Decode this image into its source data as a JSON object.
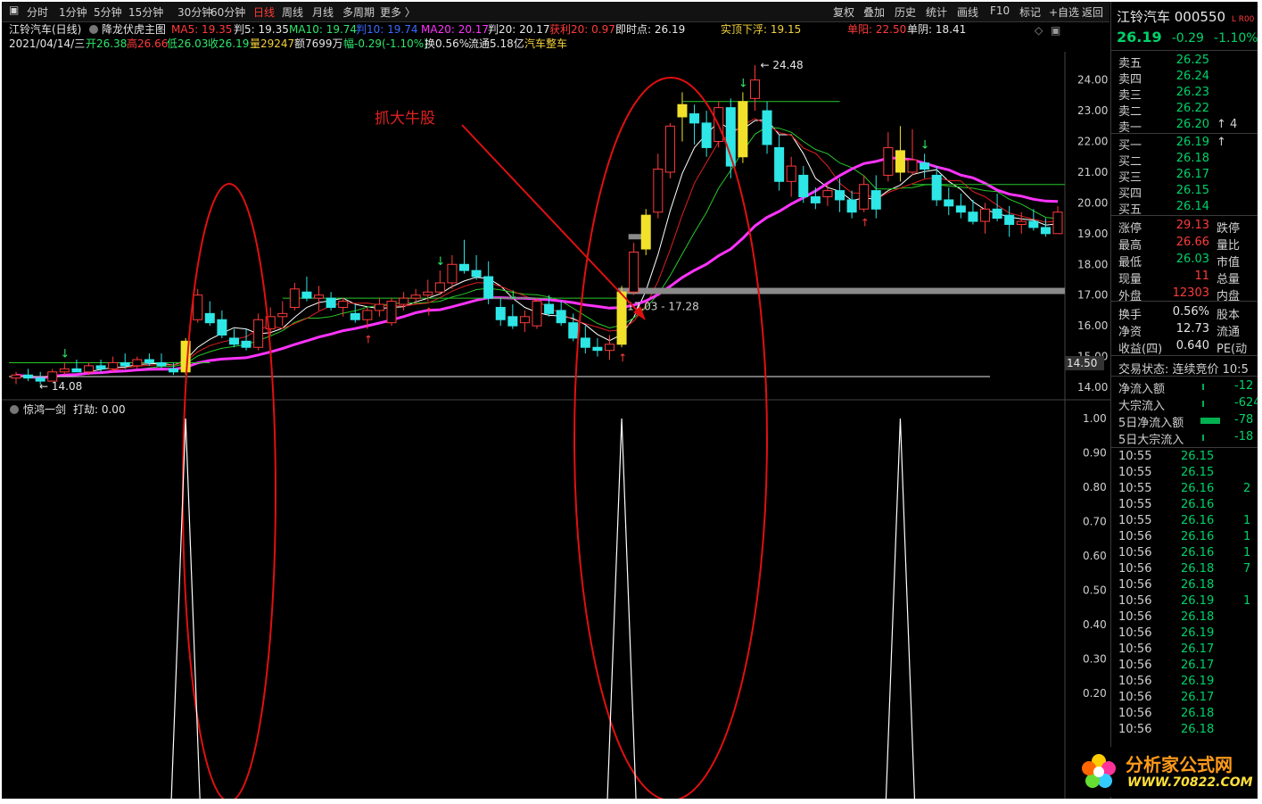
{
  "toolbar": {
    "periods": [
      "分时",
      "1分钟",
      "5分钟",
      "15分钟",
      "30分钟",
      "60分钟",
      "日线",
      "周线",
      "月线",
      "多周期",
      "更多 〉"
    ],
    "active_period": "日线",
    "right_items": [
      "复权",
      "叠加",
      "历史",
      "统计",
      "画线",
      "F10",
      "标记",
      "+自选",
      "返回"
    ]
  },
  "info_line1": {
    "title": "江铃汽车(日线)",
    "indicator": "降龙伏虎主图",
    "ma5": "MA5: 19.35",
    "pan5": "判5: 19.35",
    "ma10": "MA10: 19.74",
    "pan10": "判10: 19.74",
    "ma20": "MA20: 20.17",
    "pan20": "判20: 20.17",
    "profit20": "获利20: 0.97",
    "instant": "即时点: 26.19",
    "top_float": "实顶下浮: 19.15",
    "single_yang": "单阳: 22.50",
    "single_top": "单阴: 18.41"
  },
  "info_line2": {
    "date": "2021/04/14/三",
    "open": "开26.38",
    "high": "高26.66",
    "low": "低26.03",
    "close": "收26.19",
    "volume": "量29247",
    "amount": "额7699万",
    "amplitude": "幅-0.29(-1.10%)",
    "turnover": "换0.56%",
    "float_cap": "流通5.18亿",
    "sector": "汽车整车"
  },
  "annotations": {
    "catch_bull": "抓大牛股",
    "high_label": "24.48",
    "low_label": "14.08",
    "range_label": "17.03 - 17.28",
    "cursor_price": "14.50"
  },
  "price_axis": [
    "24.00",
    "23.00",
    "22.00",
    "21.00",
    "20.00",
    "19.00",
    "18.00",
    "17.00",
    "16.00",
    "15.00",
    "14.00"
  ],
  "sub_chart": {
    "title": "惊鸿一剑",
    "value": "打劫: 0.00",
    "axis": [
      "1.00",
      "0.90",
      "0.80",
      "0.70",
      "0.60",
      "0.50",
      "0.40",
      "0.30",
      "0.20"
    ]
  },
  "colors": {
    "up": "#ff3b3b",
    "down": "#2ee6e6",
    "signal": "#f2e12a",
    "ma_white": "#ffffff",
    "ma_magenta": "#ff33ff",
    "ma_green": "#28c828",
    "ellipse": "#e01010"
  },
  "chart_data": {
    "type": "candlestick",
    "ylim": [
      14.0,
      24.6
    ],
    "candles": [
      {
        "o": 14.3,
        "h": 14.5,
        "l": 14.1,
        "c": 14.4
      },
      {
        "o": 14.4,
        "h": 14.6,
        "l": 14.2,
        "c": 14.3
      },
      {
        "o": 14.3,
        "h": 14.5,
        "l": 14.08,
        "c": 14.2
      },
      {
        "o": 14.2,
        "h": 14.6,
        "l": 14.2,
        "c": 14.5
      },
      {
        "o": 14.5,
        "h": 14.8,
        "l": 14.4,
        "c": 14.6
      },
      {
        "o": 14.6,
        "h": 14.9,
        "l": 14.5,
        "c": 14.5
      },
      {
        "o": 14.5,
        "h": 14.8,
        "l": 14.4,
        "c": 14.7
      },
      {
        "o": 14.7,
        "h": 14.9,
        "l": 14.5,
        "c": 14.6
      },
      {
        "o": 14.6,
        "h": 15.0,
        "l": 14.5,
        "c": 14.8
      },
      {
        "o": 14.8,
        "h": 15.1,
        "l": 14.6,
        "c": 14.7
      },
      {
        "o": 14.7,
        "h": 15.0,
        "l": 14.6,
        "c": 14.9
      },
      {
        "o": 14.9,
        "h": 15.1,
        "l": 14.7,
        "c": 14.8
      },
      {
        "o": 14.8,
        "h": 15.1,
        "l": 14.6,
        "c": 14.7
      },
      {
        "o": 14.6,
        "h": 14.8,
        "l": 14.4,
        "c": 14.5
      },
      {
        "o": 14.5,
        "h": 15.6,
        "l": 14.4,
        "c": 15.5
      },
      {
        "o": 16.2,
        "h": 17.2,
        "l": 16.1,
        "c": 17.0
      },
      {
        "o": 16.4,
        "h": 16.8,
        "l": 16.0,
        "c": 16.1
      },
      {
        "o": 16.2,
        "h": 16.5,
        "l": 15.6,
        "c": 15.7
      },
      {
        "o": 15.6,
        "h": 15.9,
        "l": 15.3,
        "c": 15.4
      },
      {
        "o": 15.5,
        "h": 15.9,
        "l": 15.2,
        "c": 15.3
      },
      {
        "o": 15.3,
        "h": 16.4,
        "l": 15.2,
        "c": 16.2
      },
      {
        "o": 15.9,
        "h": 16.6,
        "l": 15.7,
        "c": 16.3
      },
      {
        "o": 16.3,
        "h": 16.8,
        "l": 16.0,
        "c": 16.4
      },
      {
        "o": 16.6,
        "h": 17.4,
        "l": 16.5,
        "c": 17.2
      },
      {
        "o": 17.1,
        "h": 17.6,
        "l": 16.8,
        "c": 16.9
      },
      {
        "o": 16.9,
        "h": 17.3,
        "l": 16.5,
        "c": 17.0
      },
      {
        "o": 16.9,
        "h": 17.1,
        "l": 16.5,
        "c": 16.6
      },
      {
        "o": 16.6,
        "h": 16.9,
        "l": 16.3,
        "c": 16.8
      },
      {
        "o": 16.4,
        "h": 16.7,
        "l": 16.1,
        "c": 16.2
      },
      {
        "o": 16.2,
        "h": 16.6,
        "l": 15.9,
        "c": 16.5
      },
      {
        "o": 16.5,
        "h": 16.9,
        "l": 16.3,
        "c": 16.7
      },
      {
        "o": 16.1,
        "h": 16.9,
        "l": 16.0,
        "c": 16.8
      },
      {
        "o": 16.7,
        "h": 17.1,
        "l": 16.5,
        "c": 16.9
      },
      {
        "o": 16.9,
        "h": 17.2,
        "l": 16.7,
        "c": 17.0
      },
      {
        "o": 17.0,
        "h": 17.5,
        "l": 16.8,
        "c": 17.1
      },
      {
        "o": 17.1,
        "h": 17.8,
        "l": 17.0,
        "c": 17.4
      },
      {
        "o": 17.4,
        "h": 18.3,
        "l": 17.2,
        "c": 18.0
      },
      {
        "o": 18.0,
        "h": 18.8,
        "l": 17.7,
        "c": 17.8
      },
      {
        "o": 17.8,
        "h": 18.3,
        "l": 17.5,
        "c": 17.6
      },
      {
        "o": 17.6,
        "h": 18.1,
        "l": 16.7,
        "c": 16.9
      },
      {
        "o": 16.6,
        "h": 16.9,
        "l": 16.0,
        "c": 16.2
      },
      {
        "o": 16.3,
        "h": 16.7,
        "l": 15.9,
        "c": 16.0
      },
      {
        "o": 16.1,
        "h": 16.5,
        "l": 15.8,
        "c": 16.3
      },
      {
        "o": 16.0,
        "h": 16.9,
        "l": 15.9,
        "c": 16.8
      },
      {
        "o": 16.7,
        "h": 17.0,
        "l": 16.3,
        "c": 16.4
      },
      {
        "o": 16.5,
        "h": 16.8,
        "l": 16.0,
        "c": 16.1
      },
      {
        "o": 16.1,
        "h": 16.4,
        "l": 15.5,
        "c": 15.6
      },
      {
        "o": 15.6,
        "h": 16.0,
        "l": 15.1,
        "c": 15.3
      },
      {
        "o": 15.3,
        "h": 15.6,
        "l": 15.0,
        "c": 15.2
      },
      {
        "o": 15.2,
        "h": 15.7,
        "l": 14.9,
        "c": 15.4
      },
      {
        "o": 15.4,
        "h": 17.3,
        "l": 15.3,
        "c": 17.1
      },
      {
        "o": 17.1,
        "h": 18.7,
        "l": 17.0,
        "c": 18.4
      },
      {
        "o": 18.5,
        "h": 19.8,
        "l": 18.3,
        "c": 19.6
      },
      {
        "o": 19.7,
        "h": 21.6,
        "l": 19.5,
        "c": 21.1
      },
      {
        "o": 21.0,
        "h": 22.6,
        "l": 20.8,
        "c": 22.5
      },
      {
        "o": 22.8,
        "h": 23.6,
        "l": 22.0,
        "c": 23.2
      },
      {
        "o": 22.9,
        "h": 23.2,
        "l": 21.9,
        "c": 22.6
      },
      {
        "o": 22.6,
        "h": 23.0,
        "l": 21.5,
        "c": 21.8
      },
      {
        "o": 22.0,
        "h": 23.3,
        "l": 21.8,
        "c": 23.1
      },
      {
        "o": 23.1,
        "h": 23.4,
        "l": 20.8,
        "c": 21.2
      },
      {
        "o": 21.5,
        "h": 23.6,
        "l": 21.3,
        "c": 23.3
      },
      {
        "o": 23.4,
        "h": 24.48,
        "l": 23.0,
        "c": 24.0
      },
      {
        "o": 23.0,
        "h": 23.3,
        "l": 21.6,
        "c": 21.9
      },
      {
        "o": 21.8,
        "h": 22.2,
        "l": 20.4,
        "c": 20.7
      },
      {
        "o": 20.7,
        "h": 21.5,
        "l": 20.2,
        "c": 21.2
      },
      {
        "o": 20.9,
        "h": 21.2,
        "l": 20.0,
        "c": 20.2
      },
      {
        "o": 20.2,
        "h": 20.5,
        "l": 19.8,
        "c": 20.0
      },
      {
        "o": 20.2,
        "h": 20.6,
        "l": 19.9,
        "c": 20.4
      },
      {
        "o": 20.4,
        "h": 20.8,
        "l": 19.7,
        "c": 20.1
      },
      {
        "o": 20.1,
        "h": 20.4,
        "l": 19.5,
        "c": 19.7
      },
      {
        "o": 19.8,
        "h": 20.9,
        "l": 19.7,
        "c": 20.6
      },
      {
        "o": 20.4,
        "h": 20.9,
        "l": 19.5,
        "c": 19.8
      },
      {
        "o": 20.9,
        "h": 22.3,
        "l": 20.7,
        "c": 21.8
      },
      {
        "o": 21.7,
        "h": 22.5,
        "l": 20.7,
        "c": 21.0
      },
      {
        "o": 21.0,
        "h": 22.4,
        "l": 20.9,
        "c": 21.4
      },
      {
        "o": 21.3,
        "h": 21.6,
        "l": 20.8,
        "c": 21.1
      },
      {
        "o": 20.9,
        "h": 21.2,
        "l": 19.9,
        "c": 20.1
      },
      {
        "o": 20.1,
        "h": 20.5,
        "l": 19.6,
        "c": 19.9
      },
      {
        "o": 19.9,
        "h": 20.3,
        "l": 19.5,
        "c": 19.7
      },
      {
        "o": 19.7,
        "h": 20.1,
        "l": 19.3,
        "c": 19.4
      },
      {
        "o": 19.4,
        "h": 20.0,
        "l": 19.0,
        "c": 19.8
      },
      {
        "o": 19.8,
        "h": 20.3,
        "l": 19.4,
        "c": 19.5
      },
      {
        "o": 19.6,
        "h": 19.9,
        "l": 18.9,
        "c": 19.3
      },
      {
        "o": 19.3,
        "h": 19.7,
        "l": 19.0,
        "c": 19.4
      },
      {
        "o": 19.4,
        "h": 19.8,
        "l": 19.1,
        "c": 19.2
      },
      {
        "o": 19.2,
        "h": 19.5,
        "l": 18.9,
        "c": 19.0
      },
      {
        "o": 19.0,
        "h": 19.9,
        "l": 19.0,
        "c": 19.7
      }
    ],
    "signal_candles": [
      14,
      50,
      52,
      55,
      60,
      73
    ],
    "signal_spikes": [
      14,
      50,
      73
    ]
  },
  "sidebar": {
    "stock_title": "江铃汽车 000550",
    "title_tag": "L R00",
    "price": "26.19",
    "change": "-0.29",
    "pct": "-1.10%",
    "asks": [
      {
        "label": "卖五",
        "price": "26.25",
        "vol": ""
      },
      {
        "label": "卖四",
        "price": "26.24",
        "vol": ""
      },
      {
        "label": "卖三",
        "price": "26.23",
        "vol": ""
      },
      {
        "label": "卖二",
        "price": "26.22",
        "vol": ""
      },
      {
        "label": "卖一",
        "price": "26.20",
        "vol": "4"
      }
    ],
    "bids": [
      {
        "label": "买一",
        "price": "26.19",
        "vol": ""
      },
      {
        "label": "买二",
        "price": "26.18",
        "vol": ""
      },
      {
        "label": "买三",
        "price": "26.17",
        "vol": ""
      },
      {
        "label": "买四",
        "price": "26.15",
        "vol": ""
      },
      {
        "label": "买五",
        "price": "26.14",
        "vol": ""
      }
    ],
    "stats": [
      {
        "label": "涨停",
        "value": "29.13",
        "extra": "跌停",
        "cls": "red"
      },
      {
        "label": "最高",
        "value": "26.66",
        "extra": "量比",
        "cls": "red"
      },
      {
        "label": "最低",
        "value": "26.03",
        "extra": "市值",
        "cls": "green"
      },
      {
        "label": "现量",
        "value": "11",
        "extra": "总量",
        "cls": "red"
      },
      {
        "label": "外盘",
        "value": "12303",
        "extra": "内盘",
        "cls": "red"
      }
    ],
    "stats2": [
      {
        "label": "换手",
        "value": "0.56%",
        "extra": "股本",
        "cls": "white"
      },
      {
        "label": "净资",
        "value": "12.73",
        "extra": "流通",
        "cls": "white"
      },
      {
        "label": "收益(四)",
        "value": "0.640",
        "extra": "PE(动",
        "cls": "white"
      }
    ],
    "trade_status": "交易状态: 连续竞价 10:5",
    "flows": [
      {
        "label": "净流入额",
        "value": "-12"
      },
      {
        "label": "大宗流入",
        "value": "-624"
      },
      {
        "label": "5日净流入额",
        "value": "-78"
      },
      {
        "label": "5日大宗流入",
        "value": "-18"
      }
    ],
    "trades": [
      {
        "time": "10:55",
        "price": "26.15",
        "cls": "green",
        "vol": ""
      },
      {
        "time": "10:55",
        "price": "26.15",
        "cls": "green",
        "vol": ""
      },
      {
        "time": "10:55",
        "price": "26.16",
        "cls": "green",
        "vol": "2"
      },
      {
        "time": "10:55",
        "price": "26.16",
        "cls": "green",
        "vol": ""
      },
      {
        "time": "10:55",
        "price": "26.16",
        "cls": "green",
        "vol": "1"
      },
      {
        "time": "10:56",
        "price": "26.16",
        "cls": "green",
        "vol": "1"
      },
      {
        "time": "10:56",
        "price": "26.16",
        "cls": "green",
        "vol": "1"
      },
      {
        "time": "10:56",
        "price": "26.18",
        "cls": "green",
        "vol": "7"
      },
      {
        "time": "10:56",
        "price": "26.18",
        "cls": "green",
        "vol": ""
      },
      {
        "time": "10:56",
        "price": "26.19",
        "cls": "green",
        "vol": "1"
      },
      {
        "time": "10:56",
        "price": "26.18",
        "cls": "green",
        "vol": ""
      },
      {
        "time": "10:56",
        "price": "26.19",
        "cls": "green",
        "vol": ""
      },
      {
        "time": "10:56",
        "price": "26.17",
        "cls": "green",
        "vol": ""
      },
      {
        "time": "10:56",
        "price": "26.17",
        "cls": "green",
        "vol": ""
      },
      {
        "time": "10:56",
        "price": "26.19",
        "cls": "green",
        "vol": ""
      },
      {
        "time": "10:56",
        "price": "26.17",
        "cls": "green",
        "vol": ""
      },
      {
        "time": "10:56",
        "price": "26.18",
        "cls": "green",
        "vol": ""
      },
      {
        "time": "10:56",
        "price": "26.18",
        "cls": "green",
        "vol": ""
      }
    ]
  },
  "logo": {
    "name": "分析家公式网",
    "url": "WWW.70822.COM"
  }
}
